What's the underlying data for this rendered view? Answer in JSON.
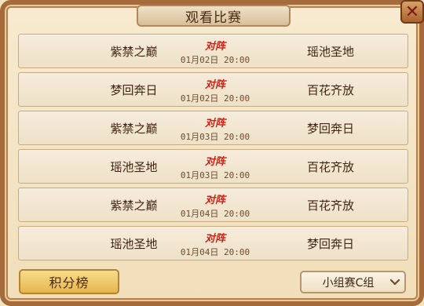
{
  "title": "观看比赛",
  "close_label": "✕",
  "vs_label": "对阵",
  "matches": [
    {
      "left": "紫禁之巅",
      "right": "瑶池圣地",
      "time": "01月02日 20:00"
    },
    {
      "left": "梦回奔日",
      "right": "百花齐放",
      "time": "01月02日 20:00"
    },
    {
      "left": "紫禁之巅",
      "right": "梦回奔日",
      "time": "01月03日 20:00"
    },
    {
      "left": "瑶池圣地",
      "right": "百花齐放",
      "time": "01月03日 20:00"
    },
    {
      "left": "紫禁之巅",
      "right": "百花齐放",
      "time": "01月04日 20:00"
    },
    {
      "left": "瑶池圣地",
      "right": "梦回奔日",
      "time": "01月04日 20:00"
    }
  ],
  "footer": {
    "ranking_button": "积分榜",
    "group_select": "小组赛C组"
  }
}
